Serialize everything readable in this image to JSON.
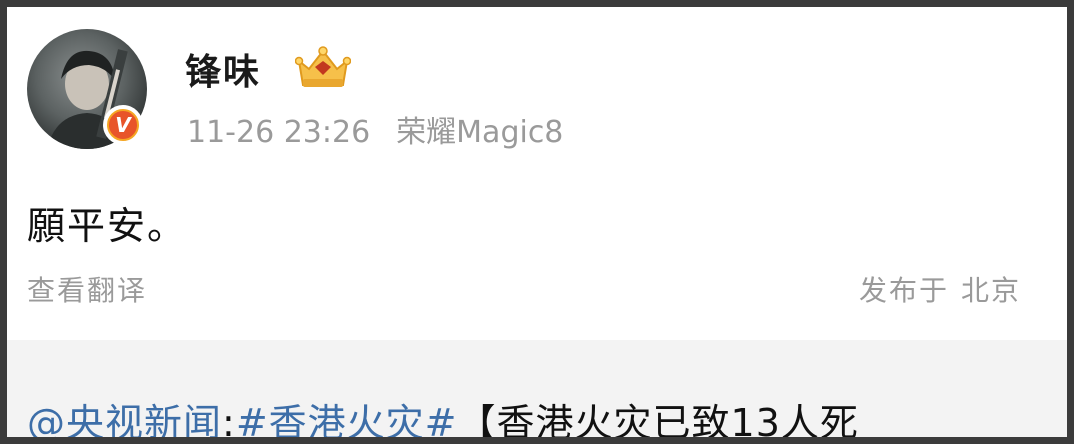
{
  "post": {
    "username": "锋味",
    "timestamp": "11-26 23:26",
    "device": "荣耀Magic8",
    "content": "願平安。",
    "translate_label": "查看翻译",
    "location_prefix": "发布于",
    "location_city": "北京",
    "verified_badge": "V"
  },
  "repost": {
    "mention": "@央视新闻",
    "separator": ":",
    "hashtag": "#香港火灾#",
    "text": "【香港火灾已致13人死"
  },
  "colors": {
    "link": "#3d6ea8",
    "meta_gray": "#9a9a9a",
    "repost_bg": "#f3f3f3",
    "badge_orange": "#e8542a"
  },
  "icons": {
    "crown": "crown-badge-icon",
    "verified": "verified-v-icon"
  }
}
